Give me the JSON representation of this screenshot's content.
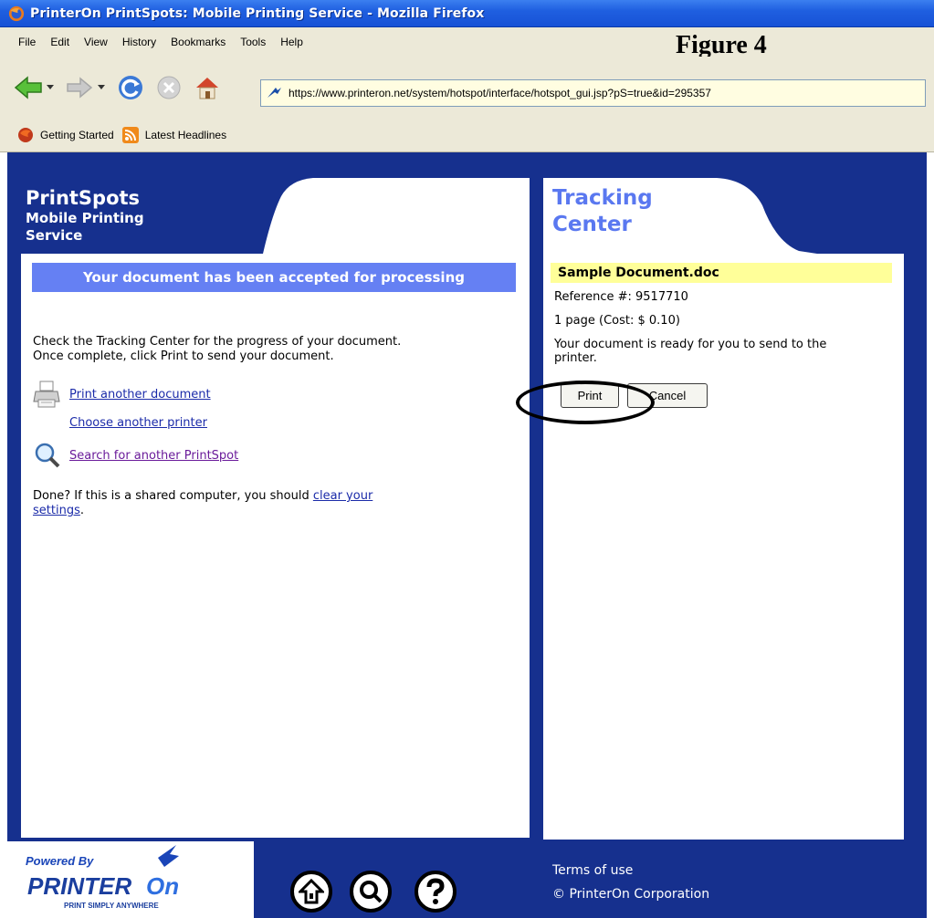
{
  "browser": {
    "window_title": "PrinterOn PrintSpots: Mobile Printing Service - Mozilla Firefox",
    "menu": [
      "File",
      "Edit",
      "View",
      "History",
      "Bookmarks",
      "Tools",
      "Help"
    ],
    "url": "https://www.printeron.net/system/hotspot/interface/hotspot_gui.jsp?pS=true&id=295357",
    "bookmarks": [
      {
        "label": "Getting Started",
        "icon": "firefox-icon"
      },
      {
        "label": "Latest Headlines",
        "icon": "rss-icon"
      }
    ]
  },
  "annotation": {
    "figure_label": "Figure 4"
  },
  "left_panel": {
    "title": "PrintSpots",
    "subtitle_line1": "Mobile Printing",
    "subtitle_line2": "Service",
    "accepted_message": "Your document has been accepted for processing",
    "instructions_line1": "Check the Tracking Center for the progress of your document.",
    "instructions_line2": "Once complete, click Print to send your document.",
    "links": {
      "print_another": "Print another document",
      "choose_printer": "Choose another printer",
      "search_printspot": "Search for another PrintSpot"
    },
    "done_prefix": "Done? If this is a shared computer, you should ",
    "clear_link_part1": "clear your",
    "clear_link_part2": "settings",
    "done_suffix": "."
  },
  "tracking_center": {
    "title_line1": "Tracking",
    "title_line2": "Center",
    "document_name": "Sample Document.doc",
    "reference": "Reference #: 9517710",
    "pages_cost": "1 page (Cost: $ 0.10)",
    "status_line1": "Your document is ready for you to send to the",
    "status_line2": "printer.",
    "print_button": "Print",
    "cancel_button": "Cancel"
  },
  "footer": {
    "powered_by": "Powered By",
    "brand": "PRINTERON",
    "tagline": "PRINT SIMPLY ANYWHERE",
    "terms": "Terms of use",
    "copyright": "© PrinterOn Corporation",
    "nav_icons": [
      "home-icon",
      "search-icon",
      "help-icon"
    ]
  },
  "colors": {
    "page_background": "#16308e",
    "accept_bar": "#6580f3",
    "heading_blue": "#5a78f0",
    "doc_highlight": "#ffff99"
  }
}
